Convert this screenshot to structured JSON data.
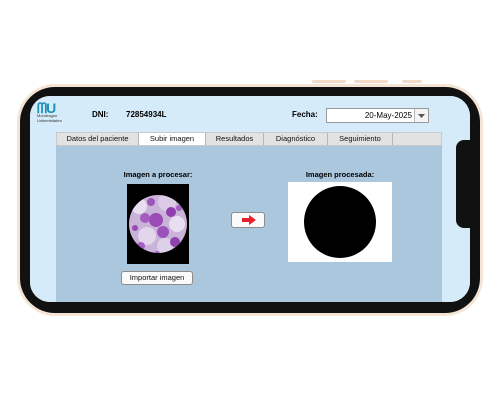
{
  "app": {
    "logo_mark": "ᗰU",
    "logo_line1": "Mondragon",
    "logo_line2": "Unibertsitatea"
  },
  "header": {
    "dni_label": "DNI:",
    "dni_value": "72854934L",
    "date_label": "Fecha:",
    "date_value": "20-May-2025"
  },
  "tabs": [
    {
      "label": "Datos del paciente"
    },
    {
      "label": "Subir imagen",
      "active": true
    },
    {
      "label": "Resultados"
    },
    {
      "label": "Diagnóstico"
    },
    {
      "label": "Seguimiento"
    }
  ],
  "main": {
    "input_title": "Imagen a procesar:",
    "output_title": "Imagen procesada:",
    "import_button": "Importar imagen"
  },
  "colors": {
    "app_bg": "#d6ebf9",
    "panel_bg": "#aac7de",
    "arrow": "#e8202a",
    "logo": "#1a93b9"
  },
  "icons": {
    "process_button": "right-arrow-icon",
    "date_dropdown": "chevron-down-icon"
  }
}
